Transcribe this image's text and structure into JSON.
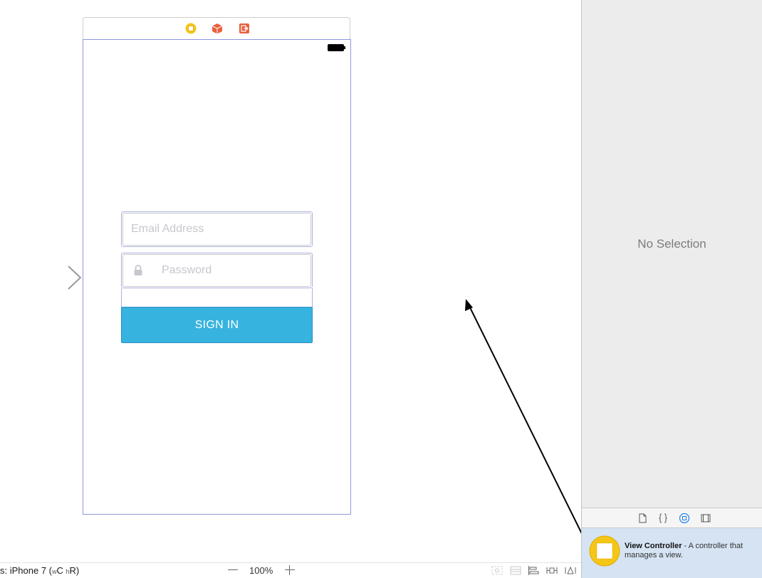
{
  "canvas": {
    "email_placeholder": "Email Address",
    "password_placeholder": "Password",
    "signin_label": "SIGN IN",
    "accent_color": "#36b3de"
  },
  "bottom_bar": {
    "view_as_prefix": "s: iPhone 7 (",
    "width_class_letter": "w",
    "width_class": "C ",
    "height_class_letter": "h",
    "height_class": "R)",
    "zoom_level": "100%"
  },
  "inspector": {
    "empty_state": "No Selection",
    "library_tabs": [
      "file-icon",
      "braces-icon",
      "object-icon",
      "media-icon"
    ],
    "library_item": {
      "title": "View Controller",
      "description": " - A controller that manages a view."
    }
  }
}
